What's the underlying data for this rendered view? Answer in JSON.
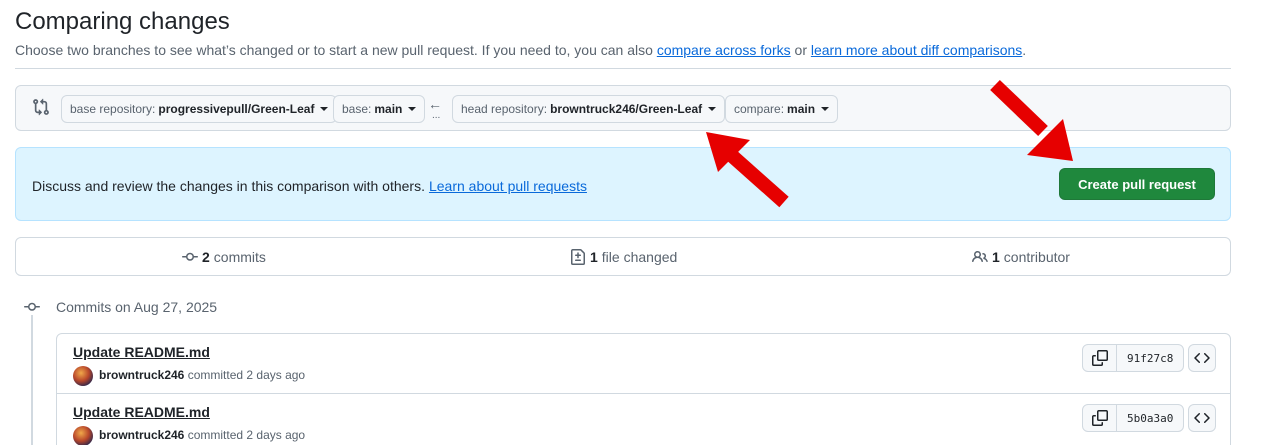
{
  "header": {
    "title": "Comparing changes",
    "subtitle_text": "Choose two branches to see what’s changed or to start a new pull request. If you need to, you can also",
    "compare_forks_link": "compare across forks",
    "or_text": "or",
    "learn_diff_link": "learn more about diff comparisons",
    "period": "."
  },
  "range": {
    "base_repo_label": "base repository:",
    "base_repo_value": "progressivepull/Green-Leaf",
    "base_label": "base:",
    "base_value": "main",
    "swap_glyph": "←",
    "swap_dots": "...",
    "head_repo_label": "head repository:",
    "head_repo_value": "browntruck246/Green-Leaf",
    "compare_label": "compare:",
    "compare_value": "main"
  },
  "info": {
    "text": "Discuss and review the changes in this comparison with others.",
    "link": "Learn about pull requests",
    "create_button": "Create pull request"
  },
  "stats": {
    "commits_count": "2",
    "commits_label": "commits",
    "files_count": "1",
    "files_label": "file changed",
    "contributors_count": "1",
    "contributors_label": "contributor"
  },
  "commits": {
    "date_header": "Commits on Aug 27, 2025",
    "items": [
      {
        "title": "Update README.md",
        "author": "browntruck246",
        "action": "committed 2 days ago",
        "sha": "91f27c8"
      },
      {
        "title": "Update README.md",
        "author": "browntruck246",
        "action": "committed 2 days ago",
        "sha": "5b0a3a0"
      }
    ]
  },
  "colors": {
    "accent_link": "#0969da",
    "create_button_bg": "#1f883d",
    "info_bg": "#ddf4ff",
    "annotation_arrow": "#e60000"
  }
}
